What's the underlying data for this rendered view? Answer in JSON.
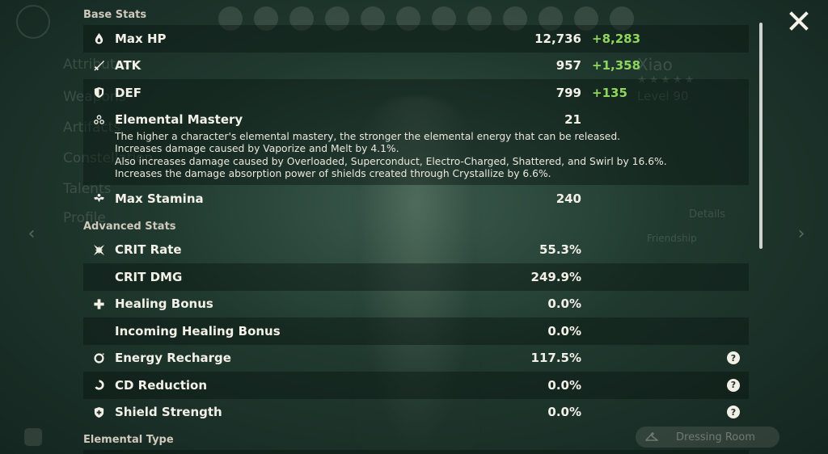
{
  "background": {
    "character_name": "Xiao",
    "level_text": "Level 90",
    "stars": "★★★★★",
    "side_menu": [
      "Attributes",
      "Weapons",
      "Artifacts",
      "Constellation",
      "Talents",
      "Profile"
    ],
    "details_label": "Details",
    "friendship_label": "Friendship"
  },
  "dressing_room_label": "Dressing Room",
  "sections": {
    "base_title": "Base Stats",
    "advanced_title": "Advanced Stats",
    "elemental_title": "Elemental Type"
  },
  "base_stats": [
    {
      "icon": "hp-drop-icon",
      "label": "Max HP",
      "value": "12,736",
      "bonus": "+8,283"
    },
    {
      "icon": "atk-sword-icon",
      "label": "ATK",
      "value": "957",
      "bonus": "+1,358"
    },
    {
      "icon": "def-shield-icon",
      "label": "DEF",
      "value": "799",
      "bonus": "+135"
    }
  ],
  "elemental_mastery": {
    "icon": "elemental-mastery-icon",
    "label": "Elemental Mastery",
    "value": "21",
    "description": [
      "The higher a character's elemental mastery, the stronger the elemental energy that can be released.",
      "Increases damage caused by Vaporize and Melt by 4.1%.",
      "Also increases damage caused by Overloaded, Superconduct, Electro-Charged, Shattered, and Swirl by 16.6%.",
      "Increases the damage absorption power of shields created through Crystallize by 6.6%."
    ]
  },
  "max_stamina": {
    "icon": "stamina-icon",
    "label": "Max Stamina",
    "value": "240"
  },
  "advanced_stats": [
    {
      "icon": "crit-rate-icon",
      "label": "CRIT Rate",
      "value": "55.3%"
    },
    {
      "icon": "",
      "label": "CRIT DMG",
      "value": "249.9%"
    },
    {
      "icon": "healing-cross-icon",
      "label": "Healing Bonus",
      "value": "0.0%"
    },
    {
      "icon": "",
      "label": "Incoming Healing Bonus",
      "value": "0.0%"
    },
    {
      "icon": "energy-recharge-icon",
      "label": "Energy Recharge",
      "value": "117.5%",
      "help": "?"
    },
    {
      "icon": "cd-reduction-icon",
      "label": "CD Reduction",
      "value": "0.0%",
      "help": "?"
    },
    {
      "icon": "shield-strength-icon",
      "label": "Shield Strength",
      "value": "0.0%",
      "help": "?"
    }
  ],
  "colors": {
    "bonus_green": "#8fd65c",
    "row_dark": "rgba(8,18,14,0.42)",
    "text": "#f3f0e7"
  }
}
